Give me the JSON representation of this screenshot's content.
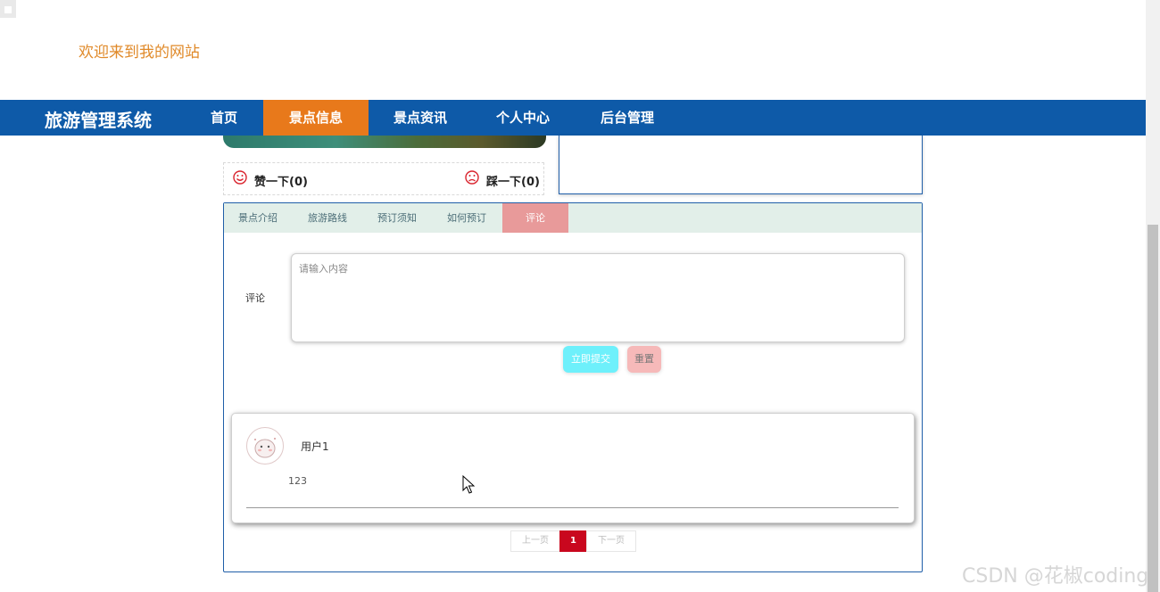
{
  "header": {
    "welcome": "欢迎来到我的网站"
  },
  "nav": {
    "brand": "旅游管理系统",
    "items": [
      {
        "label": "首页"
      },
      {
        "label": "景点信息"
      },
      {
        "label": "景点资讯"
      },
      {
        "label": "个人中心"
      },
      {
        "label": "后台管理"
      }
    ],
    "active_index": 1
  },
  "vote": {
    "like": "赞一下(0)",
    "dislike": "踩一下(0)"
  },
  "tabs": {
    "items": [
      {
        "label": "景点介绍"
      },
      {
        "label": "旅游路线"
      },
      {
        "label": "预订须知"
      },
      {
        "label": "如何预订"
      },
      {
        "label": "评论"
      }
    ],
    "active_index": 4
  },
  "comment_form": {
    "label": "评论",
    "placeholder": "请输入内容",
    "submit_label": "立即提交",
    "reset_label": "重置"
  },
  "comments": [
    {
      "user": "用户1",
      "text": "123"
    }
  ],
  "pagination": {
    "prev": "上一页",
    "current": "1",
    "next": "下一页"
  },
  "watermark": "CSDN @花椒coding",
  "colors": {
    "nav_bg": "#0e5aa8",
    "nav_active": "#e8791b",
    "tab_active": "#e89a9a",
    "submit": "#6ef0fb",
    "reset": "#f6b9b9",
    "page_current": "#c9071e"
  }
}
